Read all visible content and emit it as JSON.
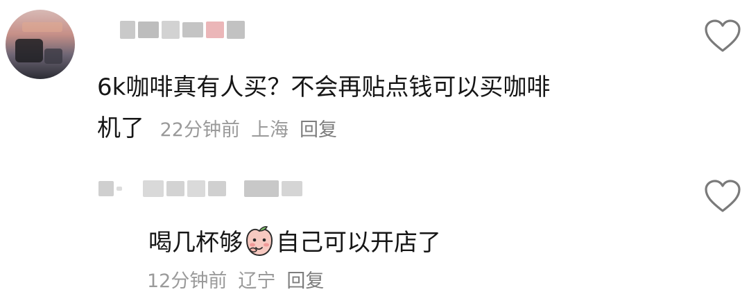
{
  "comments": [
    {
      "text_line1": "6k咖啡真有人买？不会再贴点钱可以买咖啡",
      "text_line2": "机了",
      "time": "22分钟前",
      "location": "上海",
      "reply_label": "回复",
      "like_icon": "heart-outline-icon"
    },
    {
      "text_before_emoji": "喝几杯够",
      "emoji": "peach-emoji-icon",
      "text_after_emoji": "自己可以开店了",
      "time": "12分钟前",
      "location": "辽宁",
      "reply_label": "回复",
      "like_icon": "heart-outline-icon"
    }
  ]
}
